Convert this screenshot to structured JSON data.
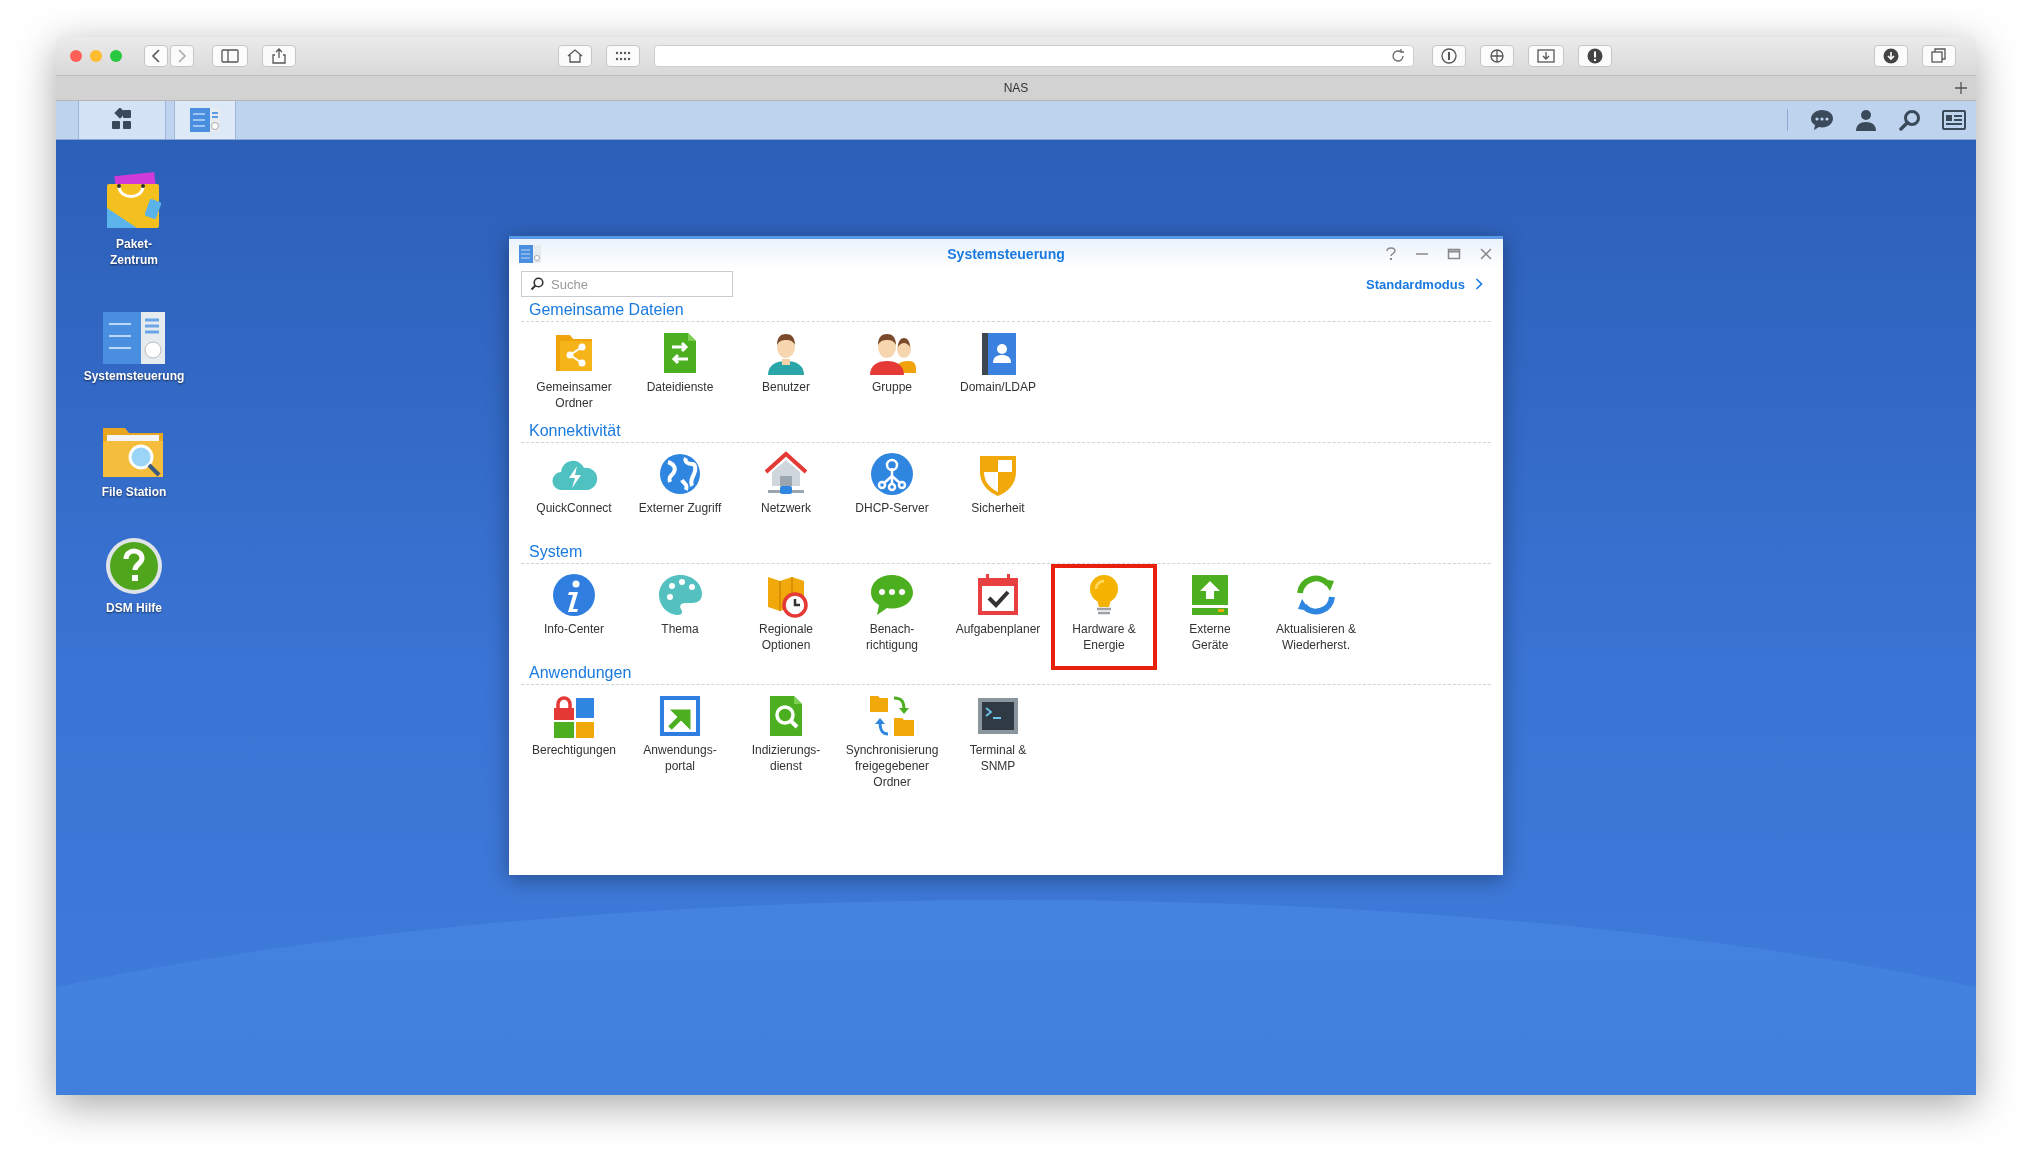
{
  "browser": {
    "tab_title": "NAS"
  },
  "desktop": {
    "shortcuts": [
      {
        "label": "Paket-\nZentrum",
        "kind": "package"
      },
      {
        "label": "Systemsteuerung",
        "kind": "control-panel"
      },
      {
        "label": "File Station",
        "kind": "file-station"
      },
      {
        "label": "DSM Hilfe",
        "kind": "help"
      }
    ]
  },
  "window": {
    "title": "Systemsteuerung",
    "search": {
      "placeholder": "Suche"
    },
    "mode_link": "Standardmodus",
    "sections": [
      {
        "title": "Gemeinsame Dateien",
        "items": [
          {
            "label": "Gemeinsamer\nOrdner",
            "kind": "shared-folder",
            "selected": false
          },
          {
            "label": "Dateidienste",
            "kind": "file-services",
            "selected": false
          },
          {
            "label": "Benutzer",
            "kind": "user",
            "selected": false
          },
          {
            "label": "Gruppe",
            "kind": "group",
            "selected": false
          },
          {
            "label": "Domain/LDAP",
            "kind": "directory",
            "selected": false
          }
        ]
      },
      {
        "title": "Konnektivität",
        "items": [
          {
            "label": "QuickConnect",
            "kind": "cloud",
            "selected": false
          },
          {
            "label": "Externer Zugriff",
            "kind": "globe",
            "selected": false
          },
          {
            "label": "Netzwerk",
            "kind": "network",
            "selected": false
          },
          {
            "label": "DHCP-Server",
            "kind": "dhcp",
            "selected": false
          },
          {
            "label": "Sicherheit",
            "kind": "shield",
            "selected": false
          }
        ]
      },
      {
        "title": "System",
        "items": [
          {
            "label": "Info-Center",
            "kind": "info",
            "selected": false
          },
          {
            "label": "Thema",
            "kind": "palette",
            "selected": false
          },
          {
            "label": "Regionale\nOptionen",
            "kind": "regional",
            "selected": false
          },
          {
            "label": "Benach-\nrichtigung",
            "kind": "chat",
            "selected": false
          },
          {
            "label": "Aufgabenplaner",
            "kind": "calendar",
            "selected": false
          },
          {
            "label": "Hardware &\nEnergie",
            "kind": "bulb",
            "selected": true
          },
          {
            "label": "Externe\nGeräte",
            "kind": "external",
            "selected": false
          },
          {
            "label": "Aktualisieren &\nWiederherst.",
            "kind": "update",
            "selected": false
          }
        ]
      },
      {
        "title": "Anwendungen",
        "items": [
          {
            "label": "Berechtigungen",
            "kind": "privileges",
            "selected": false
          },
          {
            "label": "Anwendungs-\nportal",
            "kind": "portal",
            "selected": false
          },
          {
            "label": "Indizierungs-\ndienst",
            "kind": "indexing",
            "selected": false
          },
          {
            "label": "Synchronisierung\nfreigegebener\nOrdner",
            "kind": "sync",
            "selected": false
          },
          {
            "label": "Terminal &\nSNMP",
            "kind": "terminal",
            "selected": false
          }
        ]
      }
    ]
  }
}
